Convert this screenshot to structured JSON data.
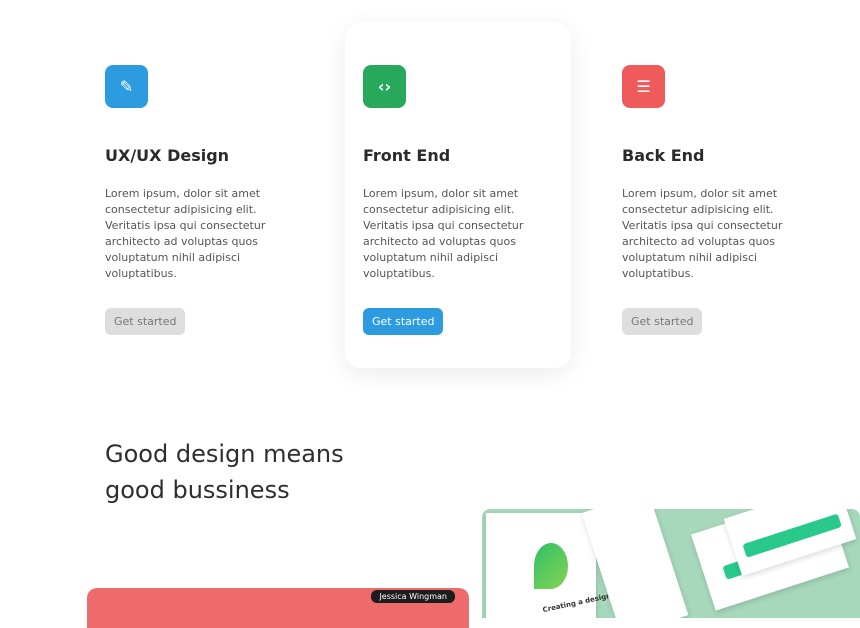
{
  "cards": [
    {
      "title": "UX/UX Design",
      "icon": "pencil-icon",
      "icon_glyph": "✎",
      "icon_color": "#2d9be0",
      "text": "Lorem ipsum, dolor sit amet consectetur adipisicing elit. Veritatis ipsa qui consectetur architecto ad voluptas quos voluptatum nihil adipisci voluptatibus.",
      "button": "Get started",
      "button_style": "grey"
    },
    {
      "title": "Front End",
      "icon": "code-icon",
      "icon_glyph": "‹›",
      "icon_color": "#28a85a",
      "text": "Lorem ipsum, dolor sit amet consectetur adipisicing elit. Veritatis ipsa qui consectetur architecto ad voluptas quos voluptatum nihil adipisci voluptatibus.",
      "button": "Get started",
      "button_style": "blue"
    },
    {
      "title": "Back End",
      "icon": "list-icon",
      "icon_glyph": "☰",
      "icon_color": "#ef5a5a",
      "text": "Lorem ipsum, dolor sit amet consectetur adipisicing elit. Veritatis ipsa qui consectetur architecto ad voluptas quos voluptatum nihil adipisci voluptatibus.",
      "button": "Get started",
      "button_style": "grey"
    }
  ],
  "section": {
    "headline_line1": "Good design means",
    "headline_line2": "good bussiness"
  },
  "gallery": {
    "left_tag": "Jessica Wingman",
    "mock_heading": "Creating a design",
    "colors": {
      "red_panel": "#ee6b6b",
      "mock_bg": "#a7d8bb",
      "mock_accent": "#29c98b"
    }
  }
}
